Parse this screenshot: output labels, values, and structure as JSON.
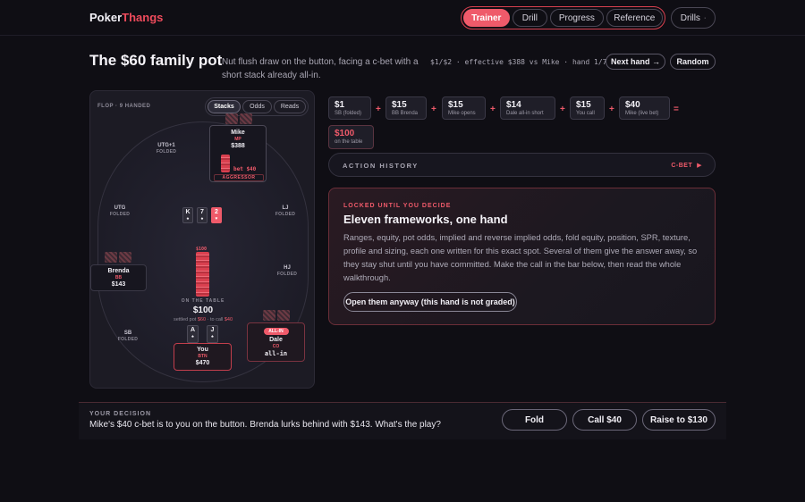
{
  "app": {
    "logo_main": "Poker",
    "logo_accent": "Thangs"
  },
  "nav": {
    "items": [
      {
        "label": "Trainer",
        "active": true
      },
      {
        "label": "Drill"
      },
      {
        "label": "Progress"
      },
      {
        "label": "Reference"
      }
    ],
    "drills_label": "Drills",
    "drills_dot": "·"
  },
  "header": {
    "title": "The $60 family pot",
    "subtitle": "Nut flush draw on the button, facing a c-bet with a short stack already all-in.",
    "meta": "$1/$2 · effective $388 vs Mike · hand 1/7",
    "next_label": "Next hand →",
    "random_label": "Random"
  },
  "table": {
    "street_label": "FLOP · 9 HANDED",
    "tabs": [
      {
        "label": "Stacks",
        "active": true
      },
      {
        "label": "Odds"
      },
      {
        "label": "Reads"
      }
    ],
    "folded_seats": [
      {
        "name": "UTG+1",
        "status": "FOLDED"
      },
      {
        "name": "UTG",
        "status": "FOLDED"
      },
      {
        "name": "LJ",
        "status": "FOLDED"
      },
      {
        "name": "HJ",
        "status": "FOLDED"
      },
      {
        "name": "SB",
        "status": "FOLDED"
      }
    ],
    "mike": {
      "name": "Mike",
      "pos": "MP",
      "stack": "$388",
      "bet": "bet $40",
      "tag": "AGGRESSOR"
    },
    "brenda": {
      "name": "Brenda",
      "pos": "BB",
      "stack": "$143"
    },
    "dale": {
      "badge": "ALL-IN",
      "name": "Dale",
      "pos": "CO",
      "stack": "all-in"
    },
    "you": {
      "name": "You",
      "pos": "BTN",
      "stack": "$470",
      "cards": [
        {
          "rank": "A",
          "suit": "♠"
        },
        {
          "rank": "J",
          "suit": "♠"
        }
      ]
    },
    "board": [
      {
        "rank": "K",
        "suit": "♠",
        "red": false
      },
      {
        "rank": "7",
        "suit": "♠",
        "red": false
      },
      {
        "rank": "2",
        "suit": "♥",
        "red": true
      }
    ],
    "pot_stack_label": "$100",
    "pot_caption": "ON THE TABLE",
    "pot_value": "$100",
    "pot_settled_prefix": "settled pot",
    "pot_settled_value": "$60",
    "pot_call_prefix": "· to call",
    "pot_call_value": "$40"
  },
  "pot_math": {
    "items": [
      {
        "value": "$1",
        "label": "SB (folded)"
      },
      {
        "value": "$15",
        "label": "BB Brenda"
      },
      {
        "value": "$15",
        "label": "Mike opens"
      },
      {
        "value": "$14",
        "label": "Dale all-in short"
      },
      {
        "value": "$15",
        "label": "You call"
      },
      {
        "value": "$40",
        "label": "Mike (live bet)"
      }
    ],
    "plus": "+",
    "equals": "=",
    "total_value": "$100",
    "total_label": "on the table"
  },
  "history": {
    "label": "ACTION HISTORY",
    "current": "C-BET",
    "arrow": "▶"
  },
  "locked": {
    "kicker": "LOCKED UNTIL YOU DECIDE",
    "title": "Eleven frameworks, one hand",
    "body": "Ranges, equity, pot odds, implied and reverse implied odds, fold equity, position, SPR, texture, profile and sizing, each one written for this exact spot. Several of them give the answer away, so they stay shut until you have committed. Make the call in the bar below, then read the whole walkthrough.",
    "button": "Open them anyway (this hand is not graded)"
  },
  "decision": {
    "kicker": "YOUR DECISION",
    "question": "Mike's $40 c-bet is to you on the button. Brenda lurks behind with $143. What's the play?",
    "actions": [
      "Fold",
      "Call $40",
      "Raise to $130"
    ]
  },
  "colors": {
    "accent": "#ef5a6a",
    "background": "#0f0e14",
    "panel": "#1c1b24"
  }
}
